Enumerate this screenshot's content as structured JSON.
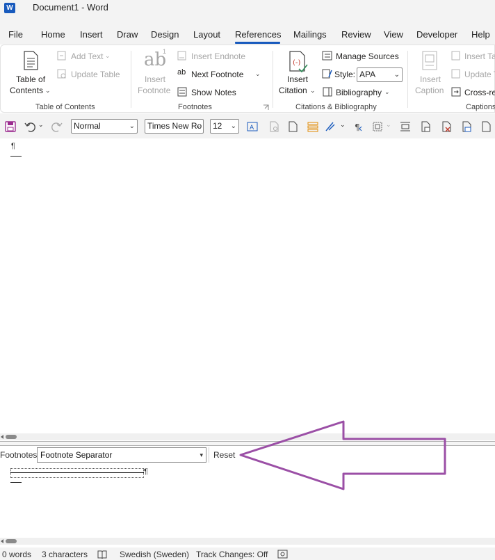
{
  "window": {
    "title": "Document1  -  Word",
    "app_badge": "W"
  },
  "tabs": [
    "File",
    "Home",
    "Insert",
    "Draw",
    "Design",
    "Layout",
    "References",
    "Mailings",
    "Review",
    "View",
    "Developer",
    "Help"
  ],
  "active_tab": "References",
  "ribbon": {
    "toc": {
      "button_line1": "Table of",
      "button_line2": "Contents",
      "add_text": "Add Text",
      "update_table": "Update Table",
      "group_label": "Table of Contents"
    },
    "footnotes": {
      "insert_line1": "Insert",
      "insert_line2": "Footnote",
      "insert_endnote": "Insert Endnote",
      "next_footnote": "Next Footnote",
      "show_notes": "Show Notes",
      "group_label": "Footnotes"
    },
    "citations": {
      "insert_line1": "Insert",
      "insert_line2": "Citation",
      "manage_sources": "Manage Sources",
      "style_label": "Style:",
      "style_value": "APA",
      "bibliography": "Bibliography",
      "group_label": "Citations & Bibliography"
    },
    "captions": {
      "insert_line1": "Insert",
      "insert_line2": "Caption",
      "insert_table": "Insert Ta",
      "update_table": "Update T",
      "cross_ref": "Cross-re",
      "group_label": "Captions"
    }
  },
  "qat": {
    "style_value": "Normal",
    "font_value": "Times New Ro",
    "size_value": "12"
  },
  "document": {
    "para_mark": "¶"
  },
  "footnote_pane": {
    "label": "Footnotes",
    "select_value": "Footnote Separator",
    "reset_label": "Reset",
    "para_mark": "¶"
  },
  "status_bar": {
    "words": "0 words",
    "characters": "3 characters",
    "language": "Swedish (Sweden)",
    "track_changes": "Track Changes: Off"
  },
  "colors": {
    "accent": "#185abd",
    "annotation_arrow": "#9b4fa6"
  }
}
